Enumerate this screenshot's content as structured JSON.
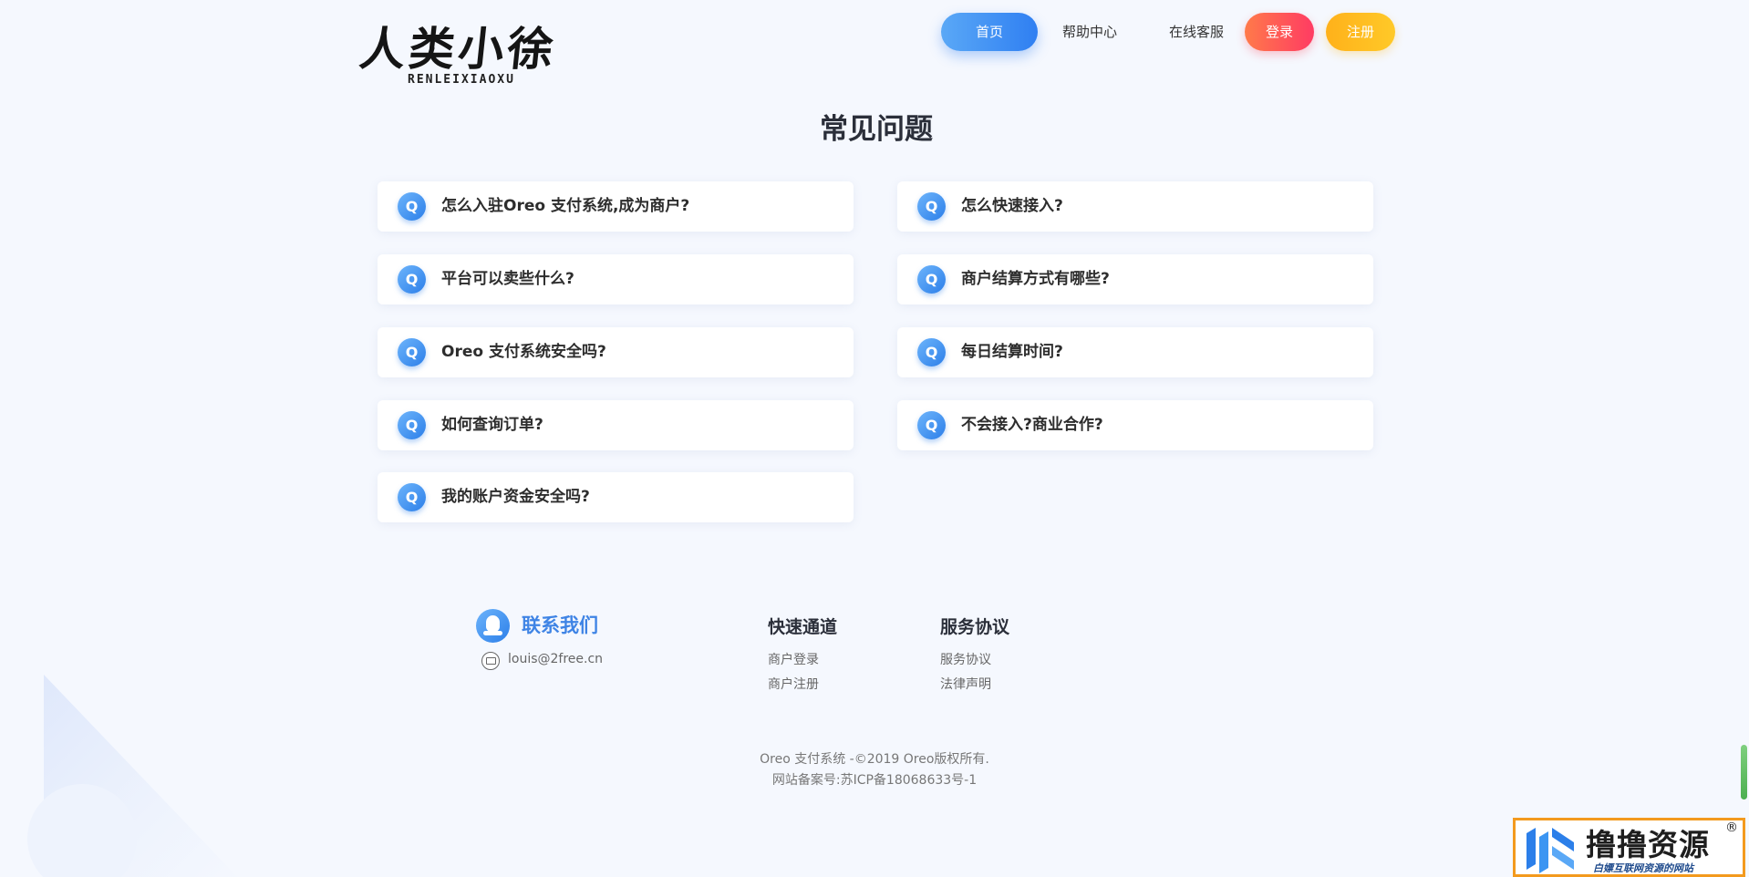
{
  "header": {
    "logo_main": "人类小徐",
    "logo_sub": "RENLEIXIAOXU",
    "nav": {
      "home": "首页",
      "help": "帮助中心",
      "service": "在线客服",
      "login": "登录",
      "register": "注册"
    }
  },
  "main": {
    "title": "常见问题",
    "faq_badge": "Q",
    "faq_left": [
      "怎么入驻Oreo 支付系统,成为商户?",
      "平台可以卖些什么?",
      "Oreo 支付系统安全吗?",
      "如何查询订单?",
      "我的账户资金安全吗?"
    ],
    "faq_right": [
      "怎么快速接入?",
      "商户结算方式有哪些?",
      "每日结算时间?",
      "不会接入?商业合作?"
    ]
  },
  "footer": {
    "contact_title": "联系我们",
    "email": "louis@2free.cn",
    "quick_title": "快速通道",
    "quick_links": [
      "商户登录",
      "商户注册"
    ],
    "service_title": "服务协议",
    "service_links": [
      "服务协议",
      "法律声明"
    ],
    "copyright": "Oreo 支付系统 -©2019 Oreo版权所有.",
    "icp": "网站备案号:苏ICP备18068633号-1"
  },
  "watermark": {
    "title": "撸撸资源",
    "reg_mark": "®",
    "subtitle": "白嫖互联网资源的网站"
  },
  "colors": {
    "accent": "#3f84e5",
    "login": "#ff3b63",
    "register": "#ffc928",
    "badge_border": "#f39a1e"
  }
}
